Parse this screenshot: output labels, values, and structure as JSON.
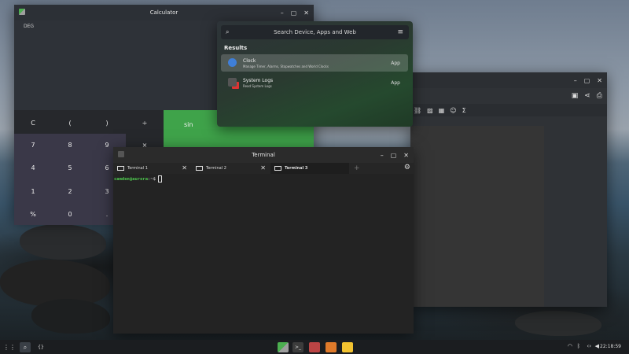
{
  "calculator": {
    "title": "Calculator",
    "mode": "DEG",
    "keys_row1": [
      "C",
      "(",
      ")",
      "÷"
    ],
    "keys": [
      "7",
      "8",
      "9",
      "×",
      "4",
      "5",
      "6",
      "1",
      "2",
      "3",
      "%",
      "0",
      "."
    ],
    "fn_label": "sin"
  },
  "search": {
    "placeholder": "Search Device, Apps and Web",
    "results_heading": "Results",
    "results": [
      {
        "title": "Clock",
        "subtitle": "Manage Timer, Alarms, Stopwatches and World Clocks",
        "badge": "App"
      },
      {
        "title": "System Logs",
        "subtitle": "Read System Logs",
        "badge": "App"
      }
    ]
  },
  "terminal": {
    "title": "Terminal",
    "tabs": [
      "Terminal 1",
      "Terminal 2",
      "Terminal 3"
    ],
    "active_tab": 2,
    "prompt_user": "camden@aurora",
    "prompt_path": ":~$"
  },
  "taskbar": {
    "clock": "22:18:59"
  },
  "colors": {
    "accent_green": "#3fa34a",
    "prompt_green": "#4ec94e"
  }
}
